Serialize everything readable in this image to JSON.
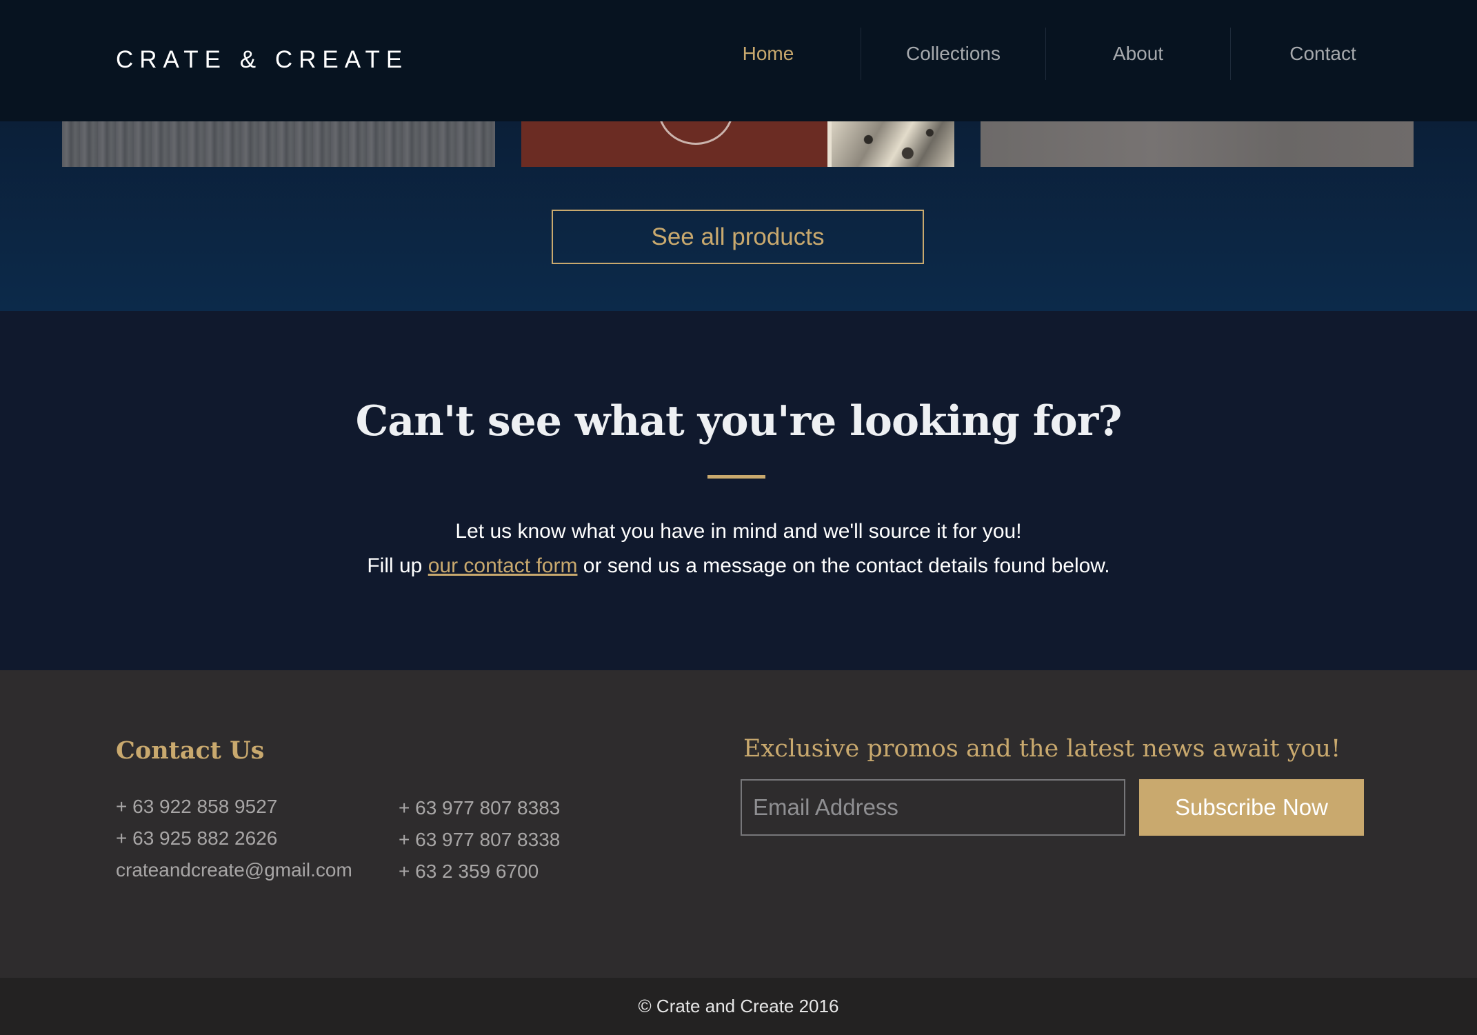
{
  "header": {
    "logo": "CRATE & CREATE",
    "nav": [
      {
        "label": "Home",
        "active": true
      },
      {
        "label": "Collections",
        "active": false
      },
      {
        "label": "About",
        "active": false
      },
      {
        "label": "Contact",
        "active": false
      }
    ]
  },
  "products": {
    "see_all_label": "See all products"
  },
  "cta": {
    "title": "Can't see what you're looking for?",
    "line1": "Let us know what you have in mind and we'll source it for you!",
    "line2_before": "Fill up ",
    "line2_link": "our contact form",
    "line2_after": " or send us a message on the contact details found below."
  },
  "footer": {
    "heading": "Contact Us",
    "contacts_col1": [
      "+ 63 922 858 9527",
      "+ 63 925 882 2626",
      "crateandcreate@gmail.com"
    ],
    "contacts_col2": [
      "+ 63 977 807 8383",
      "+ 63 977 807 8338",
      "+ 63 2 359 6700"
    ],
    "promo": "Exclusive promos and the latest news await you!",
    "email_placeholder": "Email Address",
    "subscribe_label": "Subscribe Now"
  },
  "copyright": "© Crate and Create 2016",
  "colors": {
    "accent_gold": "#c9a96e",
    "header_bg": "#071320",
    "cta_bg": "#10192d",
    "footer_bg": "#2e2c2d"
  }
}
